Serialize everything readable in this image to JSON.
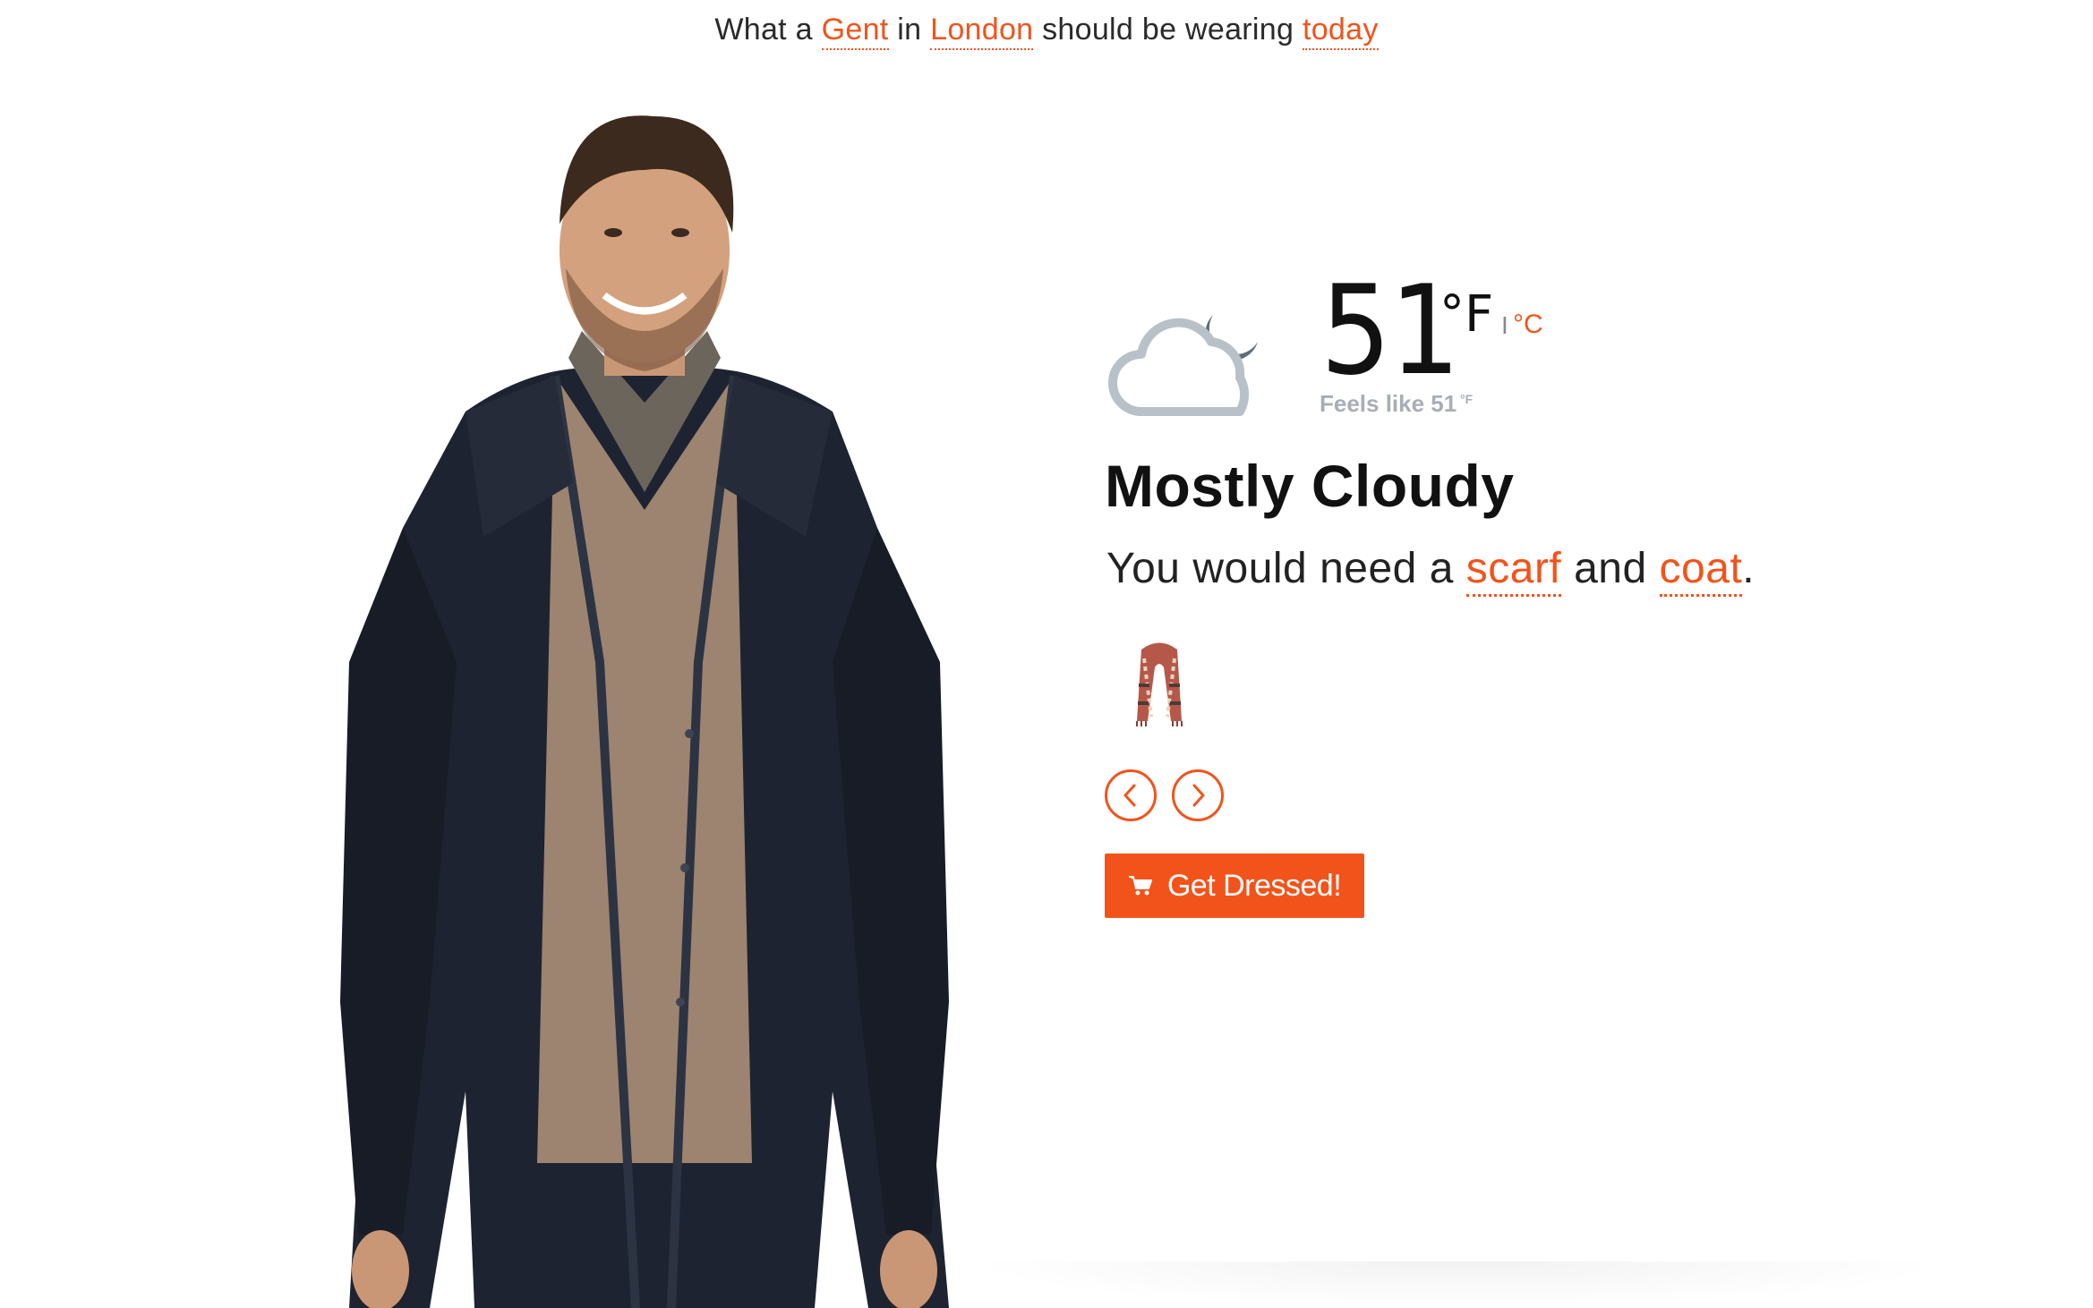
{
  "header": {
    "prefix": "What a",
    "person": "Gent",
    "in": "in",
    "city": "London",
    "middle": "should be wearing",
    "when": "today"
  },
  "weather": {
    "icon": "partly-cloudy-night-icon",
    "temperature": "51",
    "unit_f": "°F",
    "unit_separator": "I",
    "unit_c": "°C",
    "feels_like": "Feels like 51",
    "feels_unit": "°F",
    "condition": "Mostly Cloudy"
  },
  "advice": {
    "prefix": "You would need a",
    "item1": "scarf",
    "and": "and",
    "item2": "coat",
    "suffix": "."
  },
  "products": {
    "current_thumb": "scarf-thumbnail",
    "prev_icon": "chevron-left-icon",
    "next_icon": "chevron-right-icon"
  },
  "cta": {
    "icon": "cart-icon",
    "label": "Get Dressed!"
  },
  "colors": {
    "accent": "#f2531b",
    "muted": "#a7aeb6",
    "cloud": "#b9c1c8",
    "moon": "#5d6b7a"
  }
}
